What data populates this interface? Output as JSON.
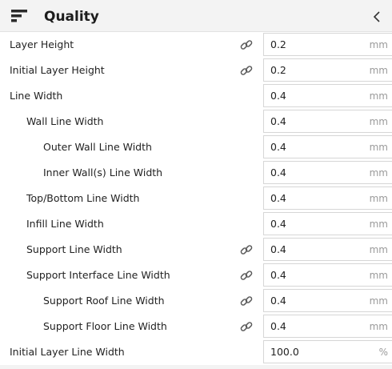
{
  "section": {
    "title": "Quality",
    "icon": "quality-bars-icon",
    "collapse_icon": "chevron-left-icon"
  },
  "settings": [
    {
      "label": "Layer Height",
      "level": 0,
      "linked": true,
      "value": "0.2",
      "unit": "mm"
    },
    {
      "label": "Initial Layer Height",
      "level": 0,
      "linked": true,
      "value": "0.2",
      "unit": "mm"
    },
    {
      "label": "Line Width",
      "level": 0,
      "linked": false,
      "value": "0.4",
      "unit": "mm"
    },
    {
      "label": "Wall Line Width",
      "level": 1,
      "linked": false,
      "value": "0.4",
      "unit": "mm"
    },
    {
      "label": "Outer Wall Line Width",
      "level": 2,
      "linked": false,
      "value": "0.4",
      "unit": "mm"
    },
    {
      "label": "Inner Wall(s) Line Width",
      "level": 2,
      "linked": false,
      "value": "0.4",
      "unit": "mm"
    },
    {
      "label": "Top/Bottom Line Width",
      "level": 1,
      "linked": false,
      "value": "0.4",
      "unit": "mm"
    },
    {
      "label": "Infill Line Width",
      "level": 1,
      "linked": false,
      "value": "0.4",
      "unit": "mm"
    },
    {
      "label": "Support Line Width",
      "level": 1,
      "linked": true,
      "value": "0.4",
      "unit": "mm"
    },
    {
      "label": "Support Interface Line Width",
      "level": 1,
      "linked": true,
      "value": "0.4",
      "unit": "mm"
    },
    {
      "label": "Support Roof Line Width",
      "level": 2,
      "linked": true,
      "value": "0.4",
      "unit": "mm"
    },
    {
      "label": "Support Floor Line Width",
      "level": 2,
      "linked": true,
      "value": "0.4",
      "unit": "mm"
    },
    {
      "label": "Initial Layer Line Width",
      "level": 0,
      "linked": false,
      "value": "100.0",
      "unit": "%"
    }
  ],
  "link_icon": "chain-link-icon",
  "colors": {
    "header_bg": "#f3f3f3",
    "field_border": "#d6d6d6",
    "unit_text": "#9a9a9a"
  }
}
